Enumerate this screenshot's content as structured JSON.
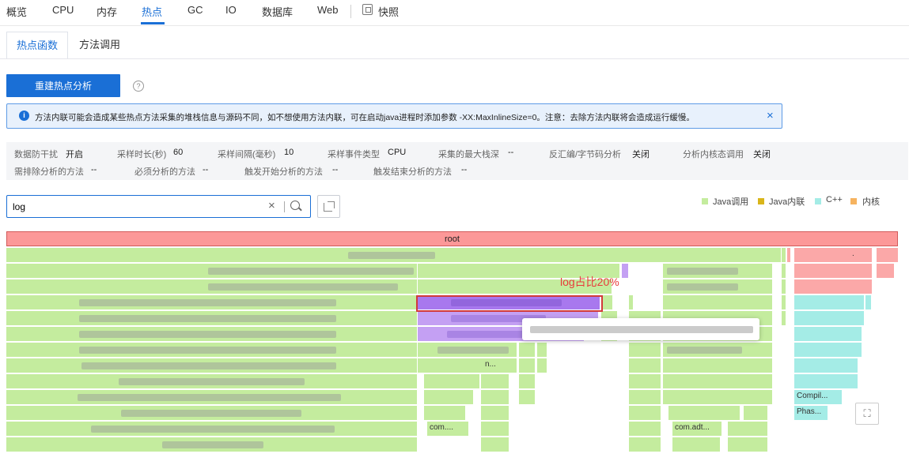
{
  "nav": {
    "tabs": [
      {
        "label": "概览"
      },
      {
        "label": "CPU"
      },
      {
        "label": "内存"
      },
      {
        "label": "热点"
      },
      {
        "label": "GC"
      },
      {
        "label": "IO"
      },
      {
        "label": "数据库"
      },
      {
        "label": "Web"
      }
    ],
    "active": "热点",
    "snapshot_label": "快照"
  },
  "subtabs": [
    {
      "label": "热点函数",
      "active": true
    },
    {
      "label": "方法调用",
      "active": false
    }
  ],
  "rebuild_button": "重建热点分析",
  "alert": {
    "text": "方法内联可能会造成某些热点方法采集的堆栈信息与源码不同，如不想使用方法内联，可在启动java进程时添加参数 -XX:MaxInlineSize=0。注意：去除方法内联将会造成运行缓慢。",
    "close": "×"
  },
  "params": {
    "row1": [
      {
        "label": "数据防干扰",
        "value": "开启"
      },
      {
        "label": "采样时长(秒)",
        "value": "60"
      },
      {
        "label": "采样间隔(毫秒)",
        "value": "10"
      },
      {
        "label": "采样事件类型",
        "value": "CPU"
      },
      {
        "label": "采集的最大栈深",
        "value": "--"
      },
      {
        "label": "反汇编/字节码分析",
        "value": "关闭"
      },
      {
        "label": "分析内核态调用",
        "value": "关闭"
      }
    ],
    "row2": [
      {
        "label": "需排除分析的方法",
        "value": "--"
      },
      {
        "label": "必须分析的方法",
        "value": "--"
      },
      {
        "label": "触发开始分析的方法",
        "value": "--"
      },
      {
        "label": "触发结束分析的方法",
        "value": "--"
      }
    ]
  },
  "search": {
    "value": "log",
    "clear": "×"
  },
  "legend": [
    {
      "label": "Java调用",
      "color": "#c4ec9e"
    },
    {
      "label": "Java内联",
      "color": "#d9b51a"
    },
    {
      "label": "C++",
      "color": "#a4ece6"
    },
    {
      "label": "内核",
      "color": "#f6b35f"
    }
  ],
  "flamegraph": {
    "root": "root",
    "annotation": "log占比20%",
    "labels": {
      "r5_dots": "...",
      "r6_pdots": "...",
      "r8_n": "n...",
      "r9_k": "...",
      "r12_compil": "Compil...",
      "r13_phas": "Phas...",
      "r14_com": "com....",
      "r14_comadt": "com.adt...",
      "kdot": "."
    }
  }
}
